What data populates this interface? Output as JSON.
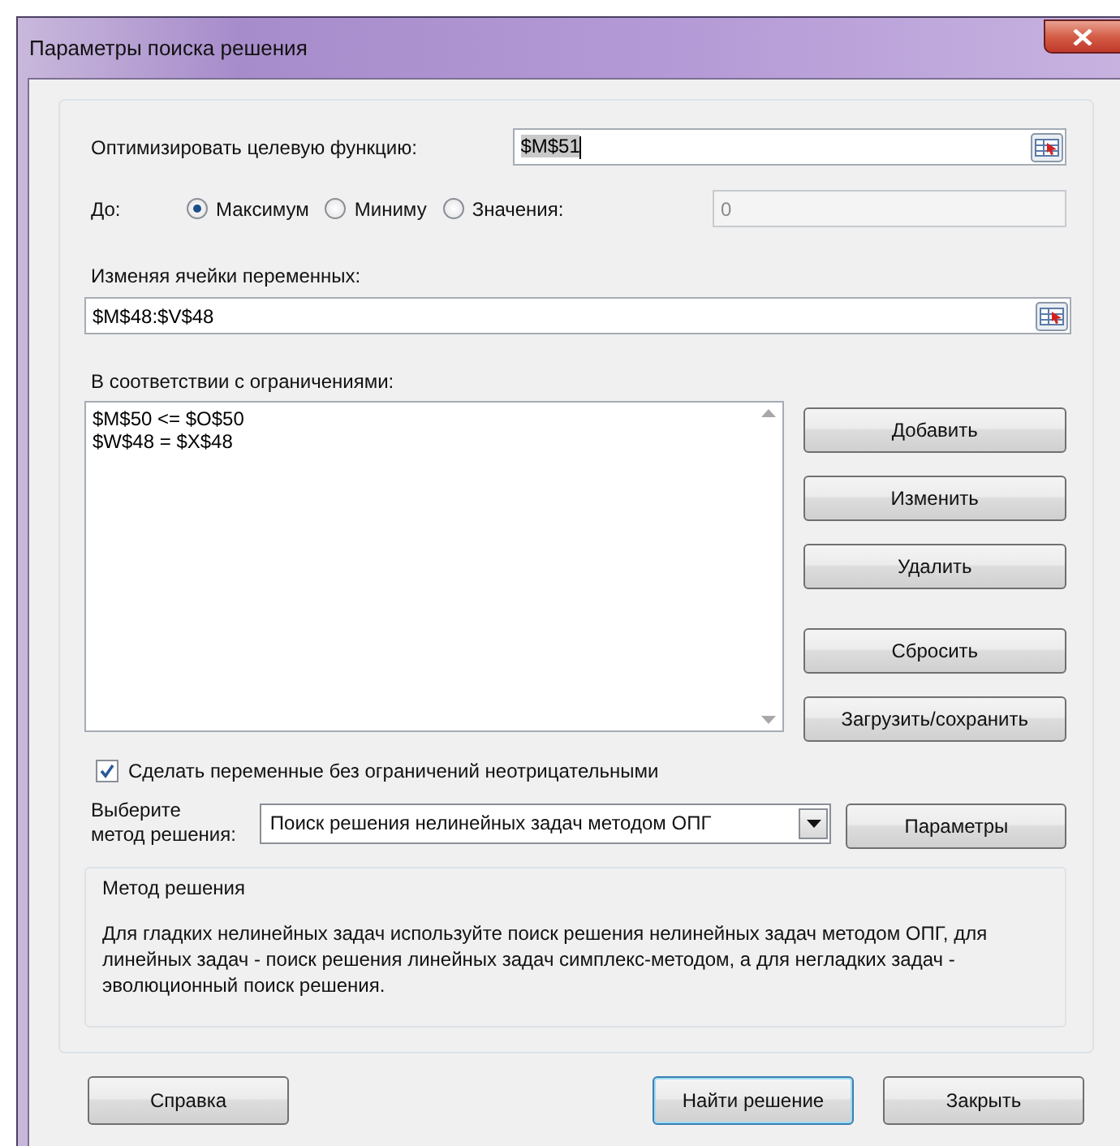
{
  "window": {
    "title": "Параметры поиска решения"
  },
  "objective": {
    "label": "Оптимизировать целевую функцию:",
    "value": "$M$51",
    "text_selected": true
  },
  "to": {
    "label": "До:",
    "options": [
      {
        "label": "Максимум",
        "selected": true
      },
      {
        "label": "Миниму",
        "selected": false
      },
      {
        "label": "Значения:",
        "selected": false
      }
    ],
    "value_field": {
      "value": "0",
      "disabled": true
    }
  },
  "variables": {
    "label": "Изменяя ячейки переменных:",
    "value": "$M$48:$V$48"
  },
  "constraints": {
    "label": "В соответствии с ограничениями:",
    "items": [
      "$M$50 <= $O$50",
      "$W$48 = $X$48"
    ],
    "buttons": [
      "Добавить",
      "Изменить",
      "Удалить",
      "Сбросить",
      "Загрузить/сохранить"
    ]
  },
  "nonnegative": {
    "label": "Сделать переменные без ограничений неотрицательными",
    "checked": true
  },
  "method": {
    "label": "Выберите метод решения:",
    "value": "Поиск решения нелинейных задач методом ОПГ",
    "button": "Параметры"
  },
  "description": {
    "title": "Метод решения",
    "text": "Для гладких нелинейных задач используйте поиск решения нелинейных задач методом ОПГ, для линейных задач - поиск решения линейных задач симплекс-методом, а для негладких задач - эволюционный поиск решения."
  },
  "footer_buttons": [
    {
      "label": "Справка",
      "default": false
    },
    {
      "label": "Найти решение",
      "default": true
    },
    {
      "label": "Закрыть",
      "default": false
    }
  ]
}
